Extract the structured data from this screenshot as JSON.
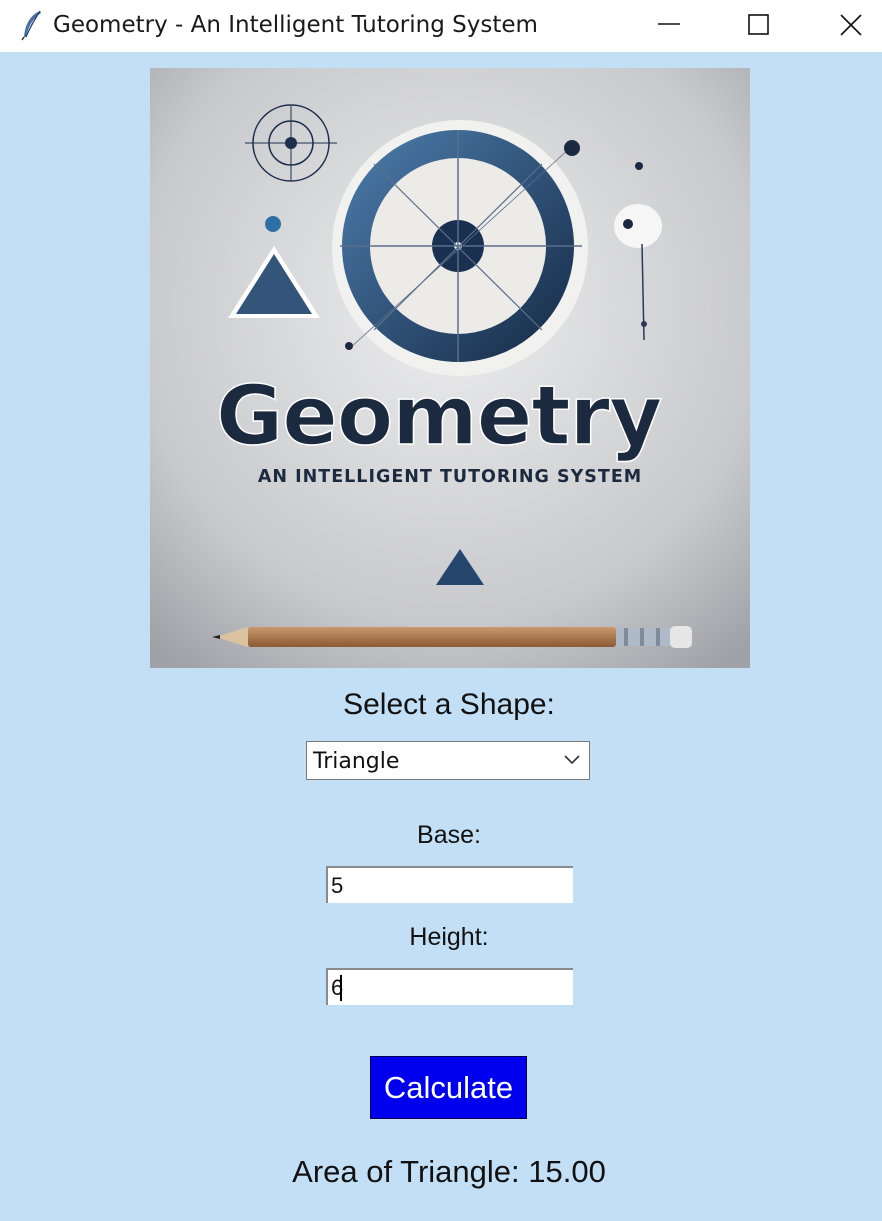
{
  "window": {
    "title": "Geometry - An Intelligent Tutoring System",
    "icon": "feather-icon",
    "controls": [
      "minimize-icon",
      "maximize-icon",
      "close-icon"
    ]
  },
  "logo": {
    "headline": "Geometry",
    "tagline": "AN INTELLIGENT TUTORING SYSTEM"
  },
  "form": {
    "select_label": "Select a Shape:",
    "shape_selected": "Triangle",
    "base_label": "Base:",
    "base_value": "5",
    "height_label": "Height:",
    "height_value": "6",
    "calculate_label": "Calculate"
  },
  "result": {
    "text": "Area of Triangle: 15.00"
  },
  "colors": {
    "background": "#c3dff5",
    "button": "#0000ee",
    "button_text": "#ffffff"
  }
}
